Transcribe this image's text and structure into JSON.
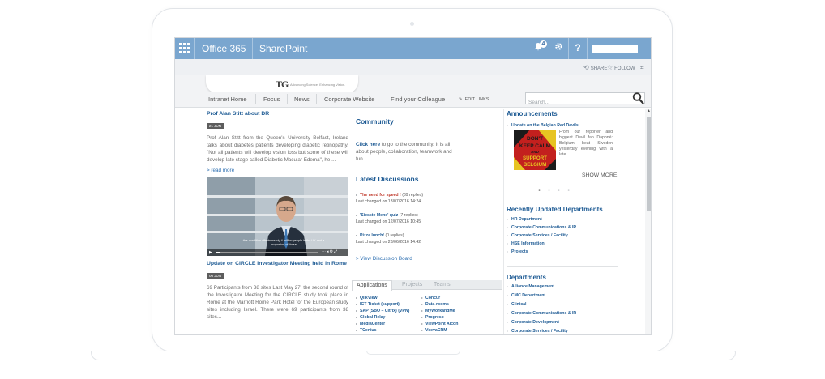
{
  "suitebar": {
    "app_launcher_icon": "waffle-icon",
    "office_label": "Office 365",
    "sharepoint_label": "SharePoint",
    "notification_count": "4",
    "icons": [
      "bell-icon",
      "gear-icon",
      "help-icon"
    ],
    "help_glyph": "?",
    "color": "#7aa6cf"
  },
  "ribbon": {
    "share_label": "SHARE",
    "follow_label": "FOLLOW"
  },
  "brand": {
    "mark": "TG",
    "slogan": "Advancing Science. Enhancing Vision."
  },
  "nav": {
    "items": [
      "Intranet Home",
      "Focus",
      "News",
      "Corporate Website",
      "Find your Colleague"
    ],
    "edit_links": "EDIT LINKS",
    "search_placeholder": "Search..."
  },
  "news": [
    {
      "title": "Prof Alan Stitt about DR",
      "date": "21 JUN",
      "body": "Prof Alan Stitt from the Queen's University Belfast, Ireland talks about diabetes patients developing diabetic retinopathy. \"Not all patients will develop vision loss but some of these will develop late stage called Diabetic Macular Edema\", he ...",
      "read_more": "> read more",
      "video_caption": "this condition affects nearly 4 million people in the UK and a proportion of those"
    },
    {
      "title": "Update on CIRCLE Investigator Meeting held in Rome",
      "date": "06 JUN",
      "body": "69 Participants from 38 sites Last May 27, the second round of the Investigator Meeting for the CIRCLE study took place in Rome at the Marriott Rome Park Hotel for the European study sites including Israel. There were 69 participants from 38 sites..."
    }
  ],
  "community": {
    "heading": "Community",
    "click_here": "Click here",
    "text": " to go to the community. It is all about people, collaboration, teamwork and fun."
  },
  "discussions": {
    "heading": "Latest Discussions",
    "items": [
      {
        "title": "The need for speed !",
        "replies": " (39 replies)",
        "changed": "Last changed on 13/07/2016 14:24"
      },
      {
        "title": "'Siesste Mens' quiz",
        "replies": " (7 replies)",
        "changed": "Last changed on 12/07/2016 10:45"
      },
      {
        "title": "Pizza lunch!",
        "replies": " (0 replies)",
        "changed": "Last changed on 23/06/2016 14:42"
      }
    ],
    "view_board": "> View Discussion Board"
  },
  "apps": {
    "tabs": [
      "Applications",
      "Projects",
      "Teams"
    ],
    "col1": [
      "QlikView",
      "ICT Ticket (support)",
      "SAP (SBO – Citrix) (VPN)",
      "Global Relay",
      "MediaCenter",
      "TCenius"
    ],
    "col2": [
      "Concur",
      "Data-rooms",
      "MyWorkandMe",
      "Progreso",
      "ViewPoint Alcon",
      "VeevaCRM"
    ]
  },
  "announcements": {
    "heading": "Announcements",
    "item_title": "Update on the Belgian Red Devils",
    "image_text": [
      "DON'T",
      "KEEP CALM",
      "AND",
      "SUPPORT",
      "BELGIUM"
    ],
    "text": "From our reporter and biggest Devil fan Daphné: Belgium beat Sweden yesterday evening with a late ...",
    "show_more": "SHOW MORE"
  },
  "recent_departments": {
    "heading": "Recently Updated Departments",
    "items": [
      "HR Department",
      "Corporate Communications & IR",
      "Corporate Services / Facility",
      "HSE Information",
      "Projects"
    ]
  },
  "departments": {
    "heading": "Departments",
    "items": [
      "Alliance Management",
      "CMC Department",
      "Clinical",
      "Corporate Communications & IR",
      "Corporate Development",
      "Corporate Services / Facility"
    ]
  }
}
